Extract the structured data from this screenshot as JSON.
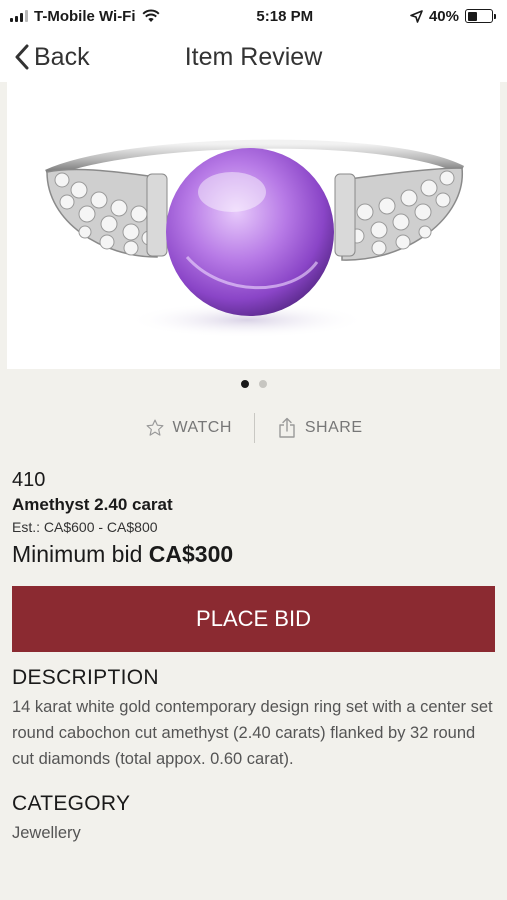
{
  "status_bar": {
    "carrier": "T-Mobile Wi-Fi",
    "time": "5:18 PM",
    "battery": "40%",
    "battery_level": 0.4
  },
  "nav": {
    "back_label": "Back",
    "title": "Item Review"
  },
  "gallery": {
    "image_alt": "Amethyst ring",
    "page_count": 2,
    "current_page": 1
  },
  "actions": {
    "watch_label": "WATCH",
    "share_label": "SHARE"
  },
  "item": {
    "lot_number": "410",
    "name": "Amethyst 2.40 carat",
    "estimate": "Est.: CA$600 - CA$800",
    "min_bid_label": "Minimum bid",
    "min_bid_value": "CA$300"
  },
  "bid_button": {
    "label": "PLACE BID",
    "color": "#8b2a31"
  },
  "description": {
    "heading": "DESCRIPTION",
    "text": "14 karat white gold contemporary design ring set with a center set round cabochon cut amethyst (2.40 carats) flanked by 32 round cut diamonds (total appox. 0.60 carat)."
  },
  "category": {
    "heading": "CATEGORY",
    "value": "Jewellery"
  }
}
